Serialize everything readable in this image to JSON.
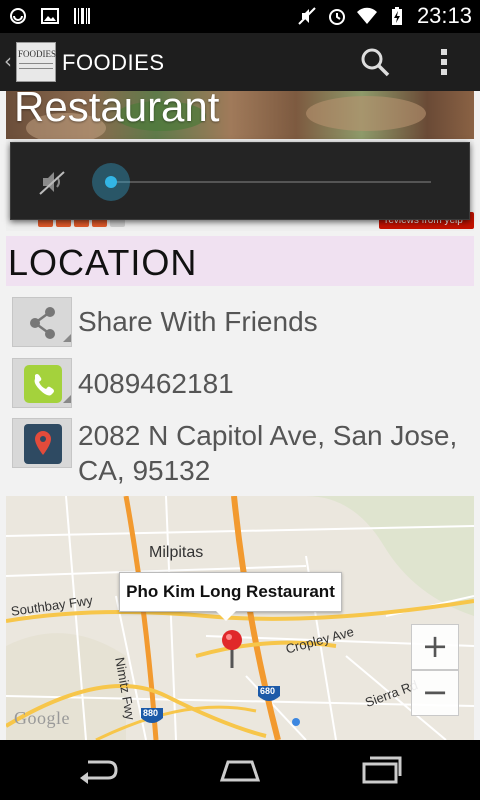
{
  "status_bar": {
    "time": "23:13"
  },
  "action_bar": {
    "title": "FOODIES",
    "logo_text": "FOODIES"
  },
  "hero": {
    "title": "Restaurant"
  },
  "rating": {
    "stars_filled": 4,
    "stars_total": 5,
    "badge_text": "reviews from yelp"
  },
  "volume": {
    "level_percent": 0
  },
  "location": {
    "header": "LOCATION",
    "share_label": "Share With Friends",
    "phone": "4089462181",
    "address_line1": "2082 N Capitol Ave, San Jose,",
    "address_line2": "CA, 95132"
  },
  "map": {
    "callout": "Pho Kim Long Restaurant",
    "labels": {
      "milpitas": "Milpitas",
      "southbay": "Southbay Fwy",
      "nimitz": "Nimitz Fwy",
      "cropley": "Cropley Ave",
      "sierra": "Sierra Rd",
      "shield_680": "680",
      "shield_880": "880"
    },
    "zoom_in": "+",
    "zoom_out": "−",
    "attribution": "Google"
  },
  "colors": {
    "location_header_bg": "#f0e1f1",
    "accent_blue": "#33b5e5",
    "star_red": "#e25a2a",
    "yelp_red": "#c41200"
  }
}
